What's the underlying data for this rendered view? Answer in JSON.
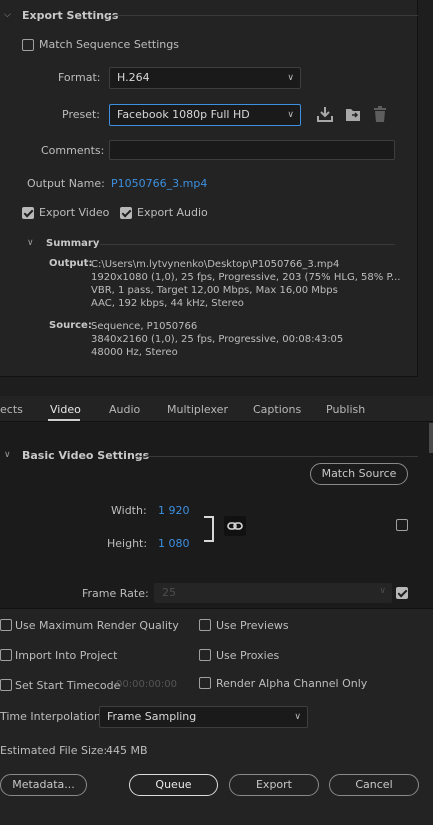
{
  "export_settings": {
    "section_title": "Export Settings",
    "match_sequence_label": "Match Sequence Settings",
    "format_label": "Format:",
    "format_value": "H.264",
    "preset_label": "Preset:",
    "preset_value": "Facebook 1080p Full HD",
    "comments_label": "Comments:",
    "comments_value": "",
    "output_name_label": "Output Name:",
    "output_name_value": "P1050766_3.mp4",
    "export_video_label": "Export Video",
    "export_audio_label": "Export Audio"
  },
  "summary": {
    "title": "Summary",
    "output_label": "Output:",
    "output_lines": [
      "C:\\Users\\m.lytvynenko\\Desktop\\P1050766_3.mp4",
      "1920x1080 (1,0), 25 fps, Progressive, 203 (75% HLG, 58% P...",
      "VBR, 1 pass, Target 12,00 Mbps, Max 16,00 Mbps",
      "AAC, 192 kbps, 44 kHz, Stereo"
    ],
    "source_label": "Source:",
    "source_lines": [
      "Sequence, P1050766",
      "3840x2160 (1,0), 25 fps, Progressive, 00:08:43:05",
      "48000 Hz, Stereo"
    ]
  },
  "tabs": [
    "ects",
    "Video",
    "Audio",
    "Multiplexer",
    "Captions",
    "Publish"
  ],
  "video": {
    "section_title": "Basic Video Settings",
    "match_source_label": "Match Source",
    "width_label": "Width:",
    "width_value": "1 920",
    "height_label": "Height:",
    "height_value": "1 080",
    "frame_rate_label": "Frame Rate:",
    "frame_rate_value": "25"
  },
  "bottom": {
    "max_render_quality": "Use Maximum Render Quality",
    "use_previews": "Use Previews",
    "import_into_project": "Import Into Project",
    "use_proxies": "Use Proxies",
    "set_start_timecode": "Set Start Timecode",
    "timecode_value": "00:00:00:00",
    "render_alpha": "Render Alpha Channel Only",
    "time_interpolation_label": "Time Interpolation:",
    "time_interpolation_value": "Frame Sampling",
    "estimated_size_label": "Estimated File Size:",
    "estimated_size_value": "445 MB",
    "metadata_button": "Metadata...",
    "queue_button": "Queue",
    "export_button": "Export",
    "cancel_button": "Cancel"
  },
  "colors": {
    "accent": "#3d8fe0",
    "background": "#232323"
  }
}
